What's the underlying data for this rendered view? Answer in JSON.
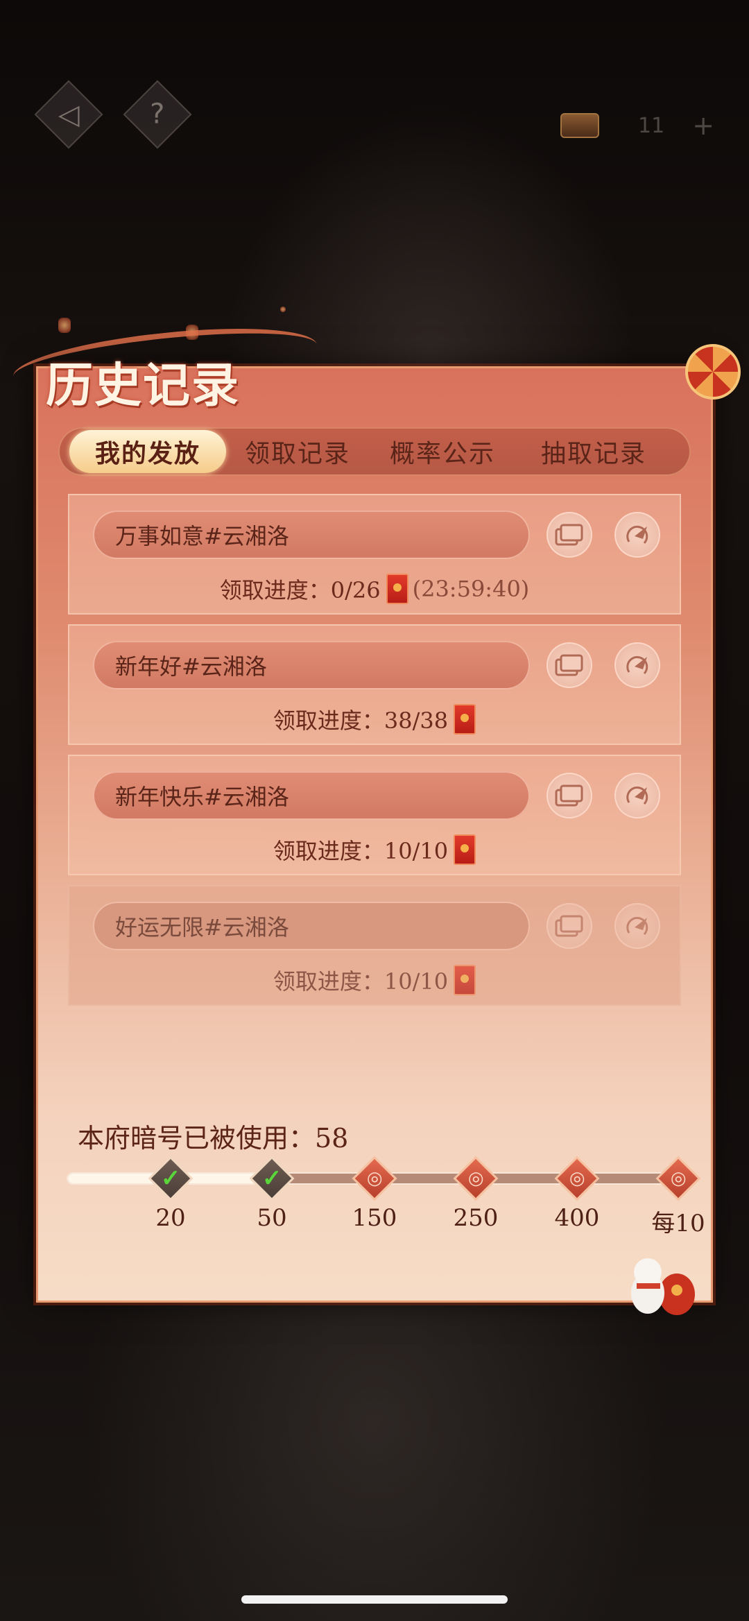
{
  "topbar": {
    "back_icon": "back-arrow-icon",
    "help_label": "?",
    "currency_value": "11",
    "add_label": "+"
  },
  "panel": {
    "title": "历史记录"
  },
  "tabs": [
    {
      "label": "我的发放",
      "active": true
    },
    {
      "label": "领取记录",
      "active": false
    },
    {
      "label": "概率公示",
      "active": false
    },
    {
      "label": "抽取记录",
      "active": false
    }
  ],
  "records": [
    {
      "name": "万事如意#云湘洛",
      "progress_label": "领取进度：0/26",
      "timer": "(23:59:40)",
      "dimmed": false
    },
    {
      "name": "新年好#云湘洛",
      "progress_label": "领取进度：38/38",
      "timer": "",
      "dimmed": false
    },
    {
      "name": "新年快乐#云湘洛",
      "progress_label": "领取进度：10/10",
      "timer": "",
      "dimmed": false
    },
    {
      "name": "好运无限#云湘洛",
      "progress_label": "领取进度：10/10",
      "timer": "",
      "dimmed": true
    }
  ],
  "usage": {
    "label": "本府暗号已被使用：58",
    "current": 58,
    "milestones": [
      {
        "label": "20",
        "reached": true
      },
      {
        "label": "50",
        "reached": true
      },
      {
        "label": "150",
        "reached": false
      },
      {
        "label": "250",
        "reached": false
      },
      {
        "label": "400",
        "reached": false
      },
      {
        "label": "每10",
        "reached": false
      }
    ],
    "check_glyph": "✓",
    "reward_glyph": "◎"
  },
  "colors": {
    "accent": "#d9725d",
    "envelope": "#d22a20",
    "check": "#5ad63a"
  }
}
